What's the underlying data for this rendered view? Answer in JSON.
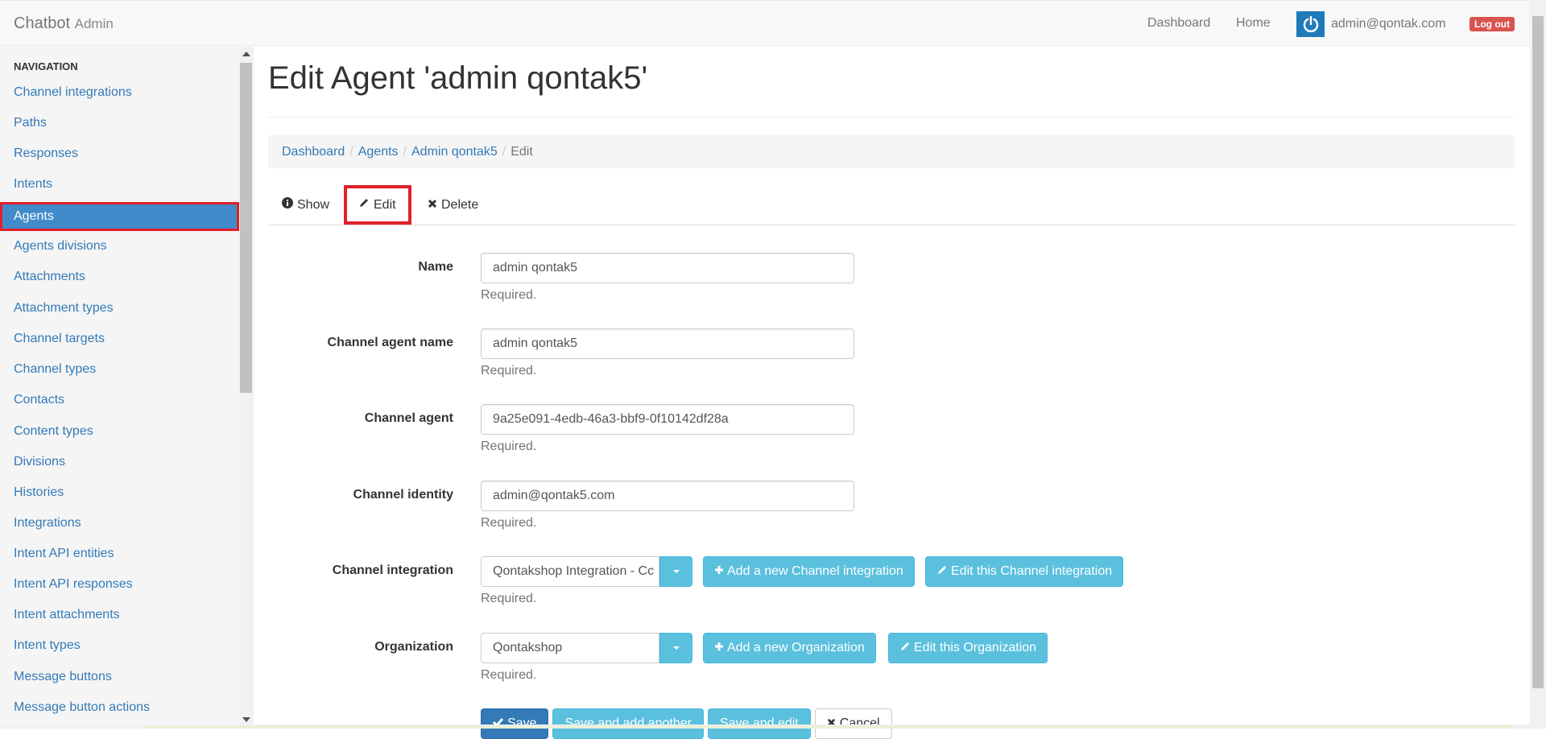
{
  "navbar": {
    "brand": "Chatbot",
    "brand_sub": "Admin",
    "links": [
      "Dashboard",
      "Home"
    ],
    "user_email": "admin@qontak.com",
    "logout_label": "Log out"
  },
  "sidebar": {
    "header": "NAVIGATION",
    "items": [
      "Channel integrations",
      "Paths",
      "Responses",
      "Intents",
      "Agents",
      "Agents divisions",
      "Attachments",
      "Attachment types",
      "Channel targets",
      "Channel types",
      "Contacts",
      "Content types",
      "Divisions",
      "Histories",
      "Integrations",
      "Intent API entities",
      "Intent API responses",
      "Intent attachments",
      "Intent types",
      "Message buttons",
      "Message button actions"
    ],
    "active_item": "Agents"
  },
  "main": {
    "title": "Edit Agent 'admin qontak5'",
    "breadcrumb": [
      "Dashboard",
      "Agents",
      "Admin qontak5",
      "Edit"
    ],
    "tabs": [
      "Show",
      "Edit",
      "Delete"
    ],
    "fields": {
      "name": {
        "label": "Name",
        "value": "admin qontak5",
        "help": "Required."
      },
      "channel_agent_name": {
        "label": "Channel agent name",
        "value": "admin qontak5",
        "help": "Required."
      },
      "channel_agent": {
        "label": "Channel agent",
        "value": "9a25e091-4edb-46a3-bbf9-0f10142df28a",
        "help": "Required."
      },
      "channel_identity": {
        "label": "Channel identity",
        "value": "admin@qontak5.com",
        "help": "Required."
      },
      "channel_integration": {
        "label": "Channel integration",
        "value": "Qontakshop Integration - Cc",
        "help": "Required.",
        "add_label": "Add a new Channel integration",
        "edit_label": "Edit this Channel integration"
      },
      "organization": {
        "label": "Organization",
        "value": "Qontakshop",
        "help": "Required.",
        "add_label": "Add a new Organization",
        "edit_label": "Edit this Organization"
      }
    },
    "actions": {
      "save": "Save",
      "save_add": "Save and add another",
      "save_edit": "Save and edit",
      "cancel": "Cancel"
    }
  },
  "colors": {
    "link": "#337ab7",
    "active_bg": "#428bca",
    "highlight_border": "#e0202a",
    "info_button": "#5bc0de",
    "danger": "#d9534f"
  }
}
